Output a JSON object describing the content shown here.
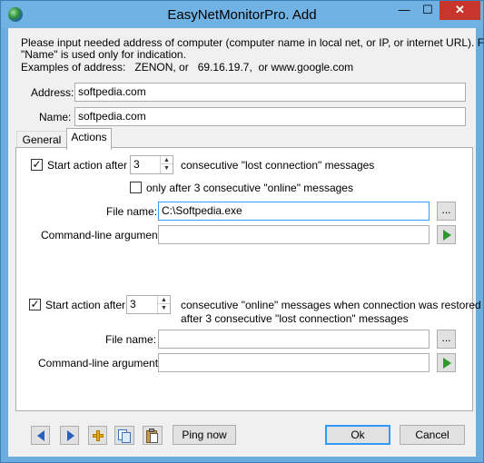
{
  "window": {
    "title": "EasyNetMonitorPro. Add",
    "minimize_glyph": "—",
    "maximize_glyph": "☐",
    "close_glyph": "✕"
  },
  "intro": {
    "line1": "Please input needed address of computer (computer name in local net, or IP, or internet URL). Field",
    "line2": "\"Name\" is used only for indication.",
    "line3": "Examples of address:   ZENON, or   69.16.19.7,  or www.google.com"
  },
  "form": {
    "address_label": "Address:",
    "address_value": "softpedia.com",
    "name_label": "Name:",
    "name_value": "softpedia.com"
  },
  "tabs": [
    {
      "label": "General",
      "active": false
    },
    {
      "label": "Actions",
      "active": true
    }
  ],
  "lost_section": {
    "checked": true,
    "check_mark": "✓",
    "start_label": "Start action after",
    "count": "3",
    "consecutive_label": "consecutive \"lost connection\" messages",
    "online_checked": false,
    "online_label": "only after 3 consecutive \"online\" messages",
    "file_label": "File name:",
    "file_value": "C:\\Softpedia.exe",
    "browse_label": "...",
    "args_label": "Command-line arguments:",
    "args_value": ""
  },
  "restore_section": {
    "checked": true,
    "check_mark": "✓",
    "start_label": "Start action after",
    "count": "3",
    "consecutive_line1": "consecutive \"online\" messages when connection was restored",
    "consecutive_line2": "after 3 consecutive \"lost connection\" messages",
    "file_label": "File name:",
    "file_value": "",
    "browse_label": "...",
    "args_label": "Command-line arguments:",
    "args_value": ""
  },
  "footer": {
    "ping_label": "Ping now",
    "ok_label": "Ok",
    "cancel_label": "Cancel"
  },
  "colors": {
    "title_bar": "#6fb2e3",
    "close_button": "#c7352b",
    "play_icon": "#2a9a2a",
    "nav_arrow": "#2b5fbf"
  }
}
